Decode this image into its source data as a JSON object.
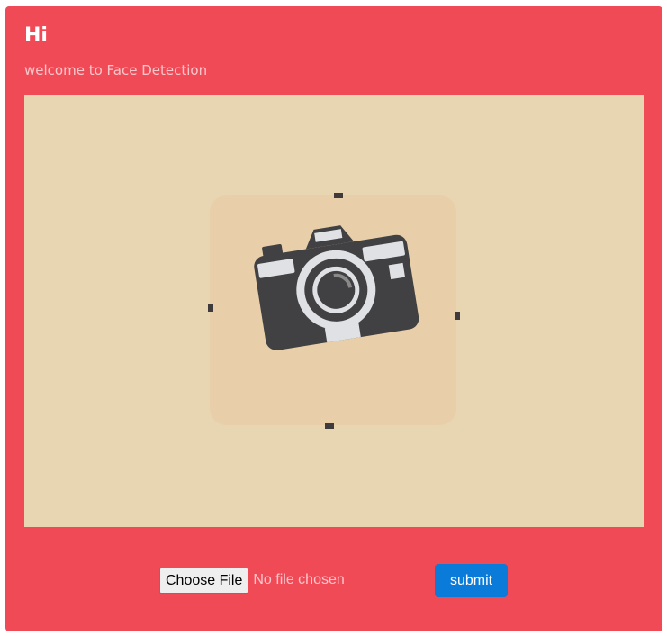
{
  "header": {
    "title": "Hi",
    "subtitle": "welcome to Face Detection"
  },
  "preview": {
    "icon": "camera-icon"
  },
  "upload": {
    "choose_file_label": "Choose File",
    "file_status": "No file chosen",
    "submit_label": "submit"
  },
  "colors": {
    "card_background": "#f14a57",
    "image_area": "#e8d6b3",
    "submit_button": "#0a7bd9"
  }
}
